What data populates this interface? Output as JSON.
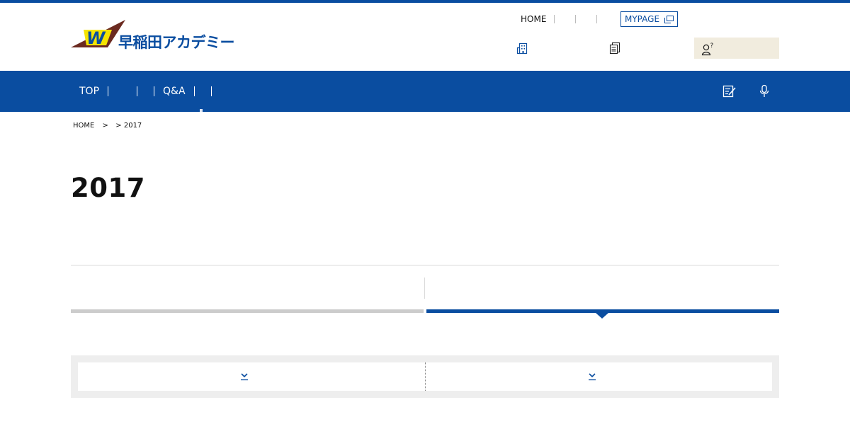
{
  "header": {
    "logo_text": "早稲田アカデミー",
    "logo_mark": "W",
    "util_nav": [
      "HOME",
      "",
      ""
    ],
    "mypage_label": "MYPAGE"
  },
  "main_nav": {
    "items": [
      "TOP",
      "",
      "Q&A",
      ""
    ]
  },
  "breadcrumb": {
    "home": "HOME",
    "sep1": " > ",
    "sep2": " > ",
    "current": "2017"
  },
  "page": {
    "title": "2017"
  },
  "colors": {
    "brand_blue": "#0a4da0",
    "logo_yellow": "#f5e400",
    "logo_brown": "#6b2a20",
    "qa_bg": "#f1ecde"
  },
  "icons": [
    "building-icon",
    "document-icon",
    "person-question-icon",
    "external-window-icon",
    "edit-note-icon",
    "microphone-icon",
    "chevron-down-icon"
  ]
}
